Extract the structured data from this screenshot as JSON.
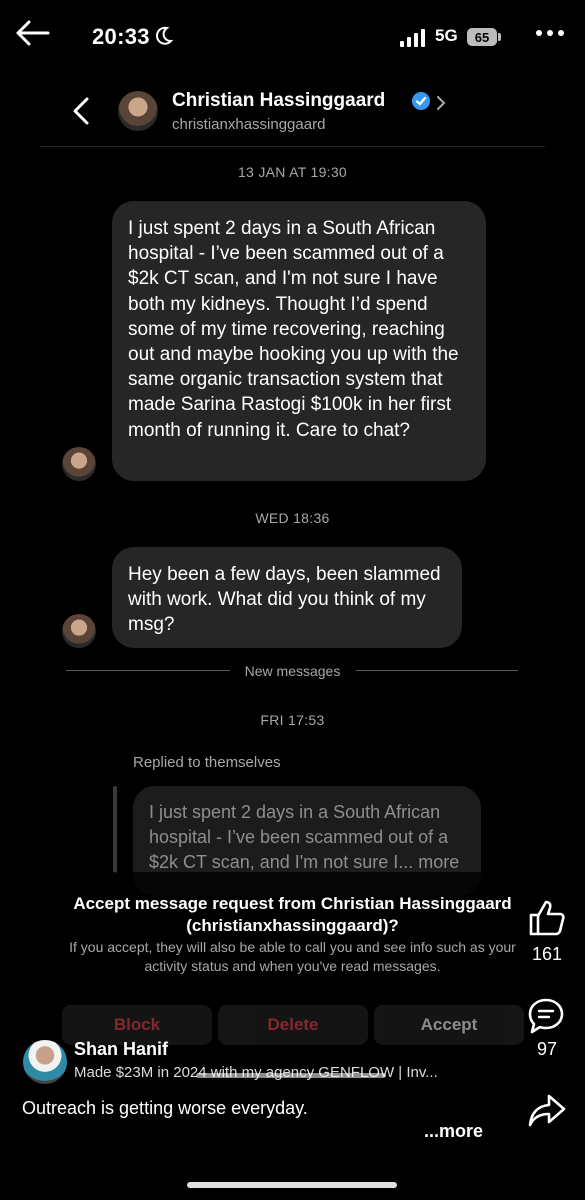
{
  "status_bar": {
    "time": "20:33",
    "network": "5G",
    "battery": "65"
  },
  "header": {
    "name": "Christian Hassinggaard",
    "handle": "christianxhassinggaard"
  },
  "conversation": {
    "timestamps": [
      "13 JAN AT 19:30",
      "WED 18:36",
      "FRI 17:53"
    ],
    "messages": [
      "I just spent 2 days in a South African hospital - I’ve been scammed out of a $2k CT scan, and I'm not sure I have both my kidneys. Thought I’d spend some of my time recovering, reaching out and maybe hooking you up with the same organic transaction system that made Sarina Rastogi $100k in her first month of running it. Care to chat?",
      "Hey been a few days, been slammed with work. What did you think of my msg?"
    ],
    "new_messages_label": "New messages",
    "replied_label": "Replied to themselves",
    "reply_preview": "I just spent 2 days in a South African hospital - I’ve been scammed out of a $2k CT scan, and I'm not sure I... more"
  },
  "request": {
    "title": "Accept message request from Christian Hassinggaard (christianxhassinggaard)?",
    "body": "If you accept, they will also be able to call you and see info such as your activity status and when you've read messages.",
    "block_label": "Block",
    "delete_label": "Delete",
    "accept_label": "Accept"
  },
  "reel": {
    "like_count": "161",
    "comment_count": "97",
    "poster_name": "Shan Hanif",
    "poster_bio": "Made $23M in 2024 with my agency GENFLOW | Inv...",
    "caption": "Outreach is getting worse everyday.",
    "more_label": "...more"
  },
  "colors": {
    "bubble": "#262626",
    "destructive": "#ed4956",
    "verified": "#3897f0",
    "muted_text": "#a8a8a8"
  },
  "icons": [
    "back-arrow-icon",
    "moon-icon",
    "signal-icon",
    "more-icon",
    "chevron-left-icon",
    "verified-icon",
    "chevron-right-icon",
    "thumbs-up-icon",
    "comment-icon",
    "share-icon"
  ]
}
